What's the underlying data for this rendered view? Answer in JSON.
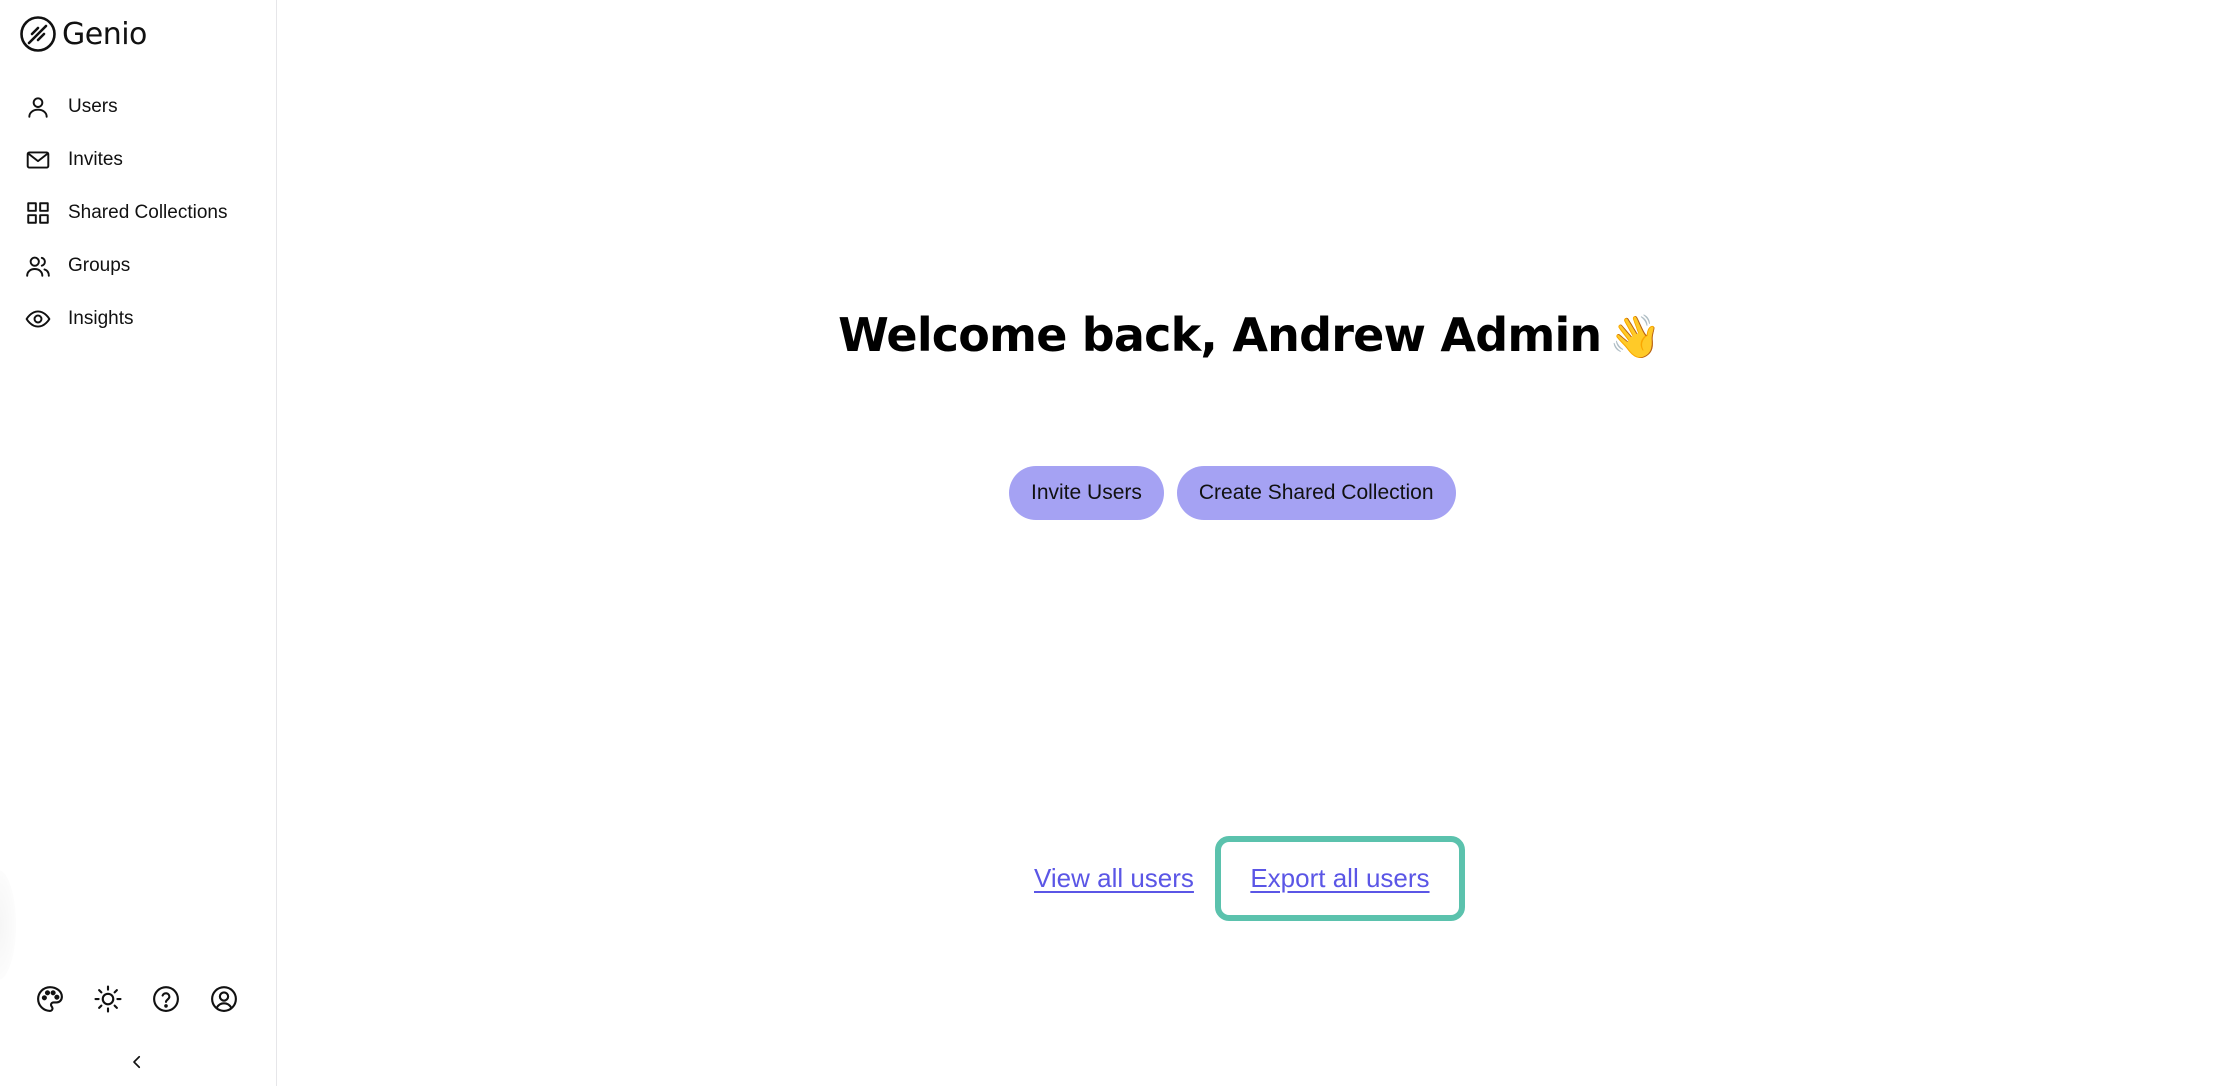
{
  "brand": {
    "name": "Genio",
    "logo_icon": "genio-logo-icon"
  },
  "sidebar": {
    "items": [
      {
        "label": "Users",
        "icon": "user-icon"
      },
      {
        "label": "Invites",
        "icon": "mail-icon"
      },
      {
        "label": "Shared Collections",
        "icon": "grid-icon"
      },
      {
        "label": "Groups",
        "icon": "users-icon"
      },
      {
        "label": "Insights",
        "icon": "eye-icon"
      }
    ],
    "bottom_tools": [
      {
        "icon": "palette-icon"
      },
      {
        "icon": "sun-icon"
      },
      {
        "icon": "help-circle-icon"
      },
      {
        "icon": "user-circle-icon"
      }
    ],
    "collapse_icon": "chevron-left-icon"
  },
  "main": {
    "welcome": "Welcome back, Andrew Admin",
    "wave_emoji": "👋",
    "buttons": {
      "invite_users": "Invite Users",
      "create_shared_collection": "Create Shared Collection"
    },
    "links": {
      "view_all_users": "View all users",
      "export_all_users": "Export all users"
    }
  },
  "colors": {
    "pill_background": "#a5a2f3",
    "link": "#5b56e6",
    "focus_ring": "#5bc2ad",
    "sidebar_border": "#e6e6e9"
  }
}
